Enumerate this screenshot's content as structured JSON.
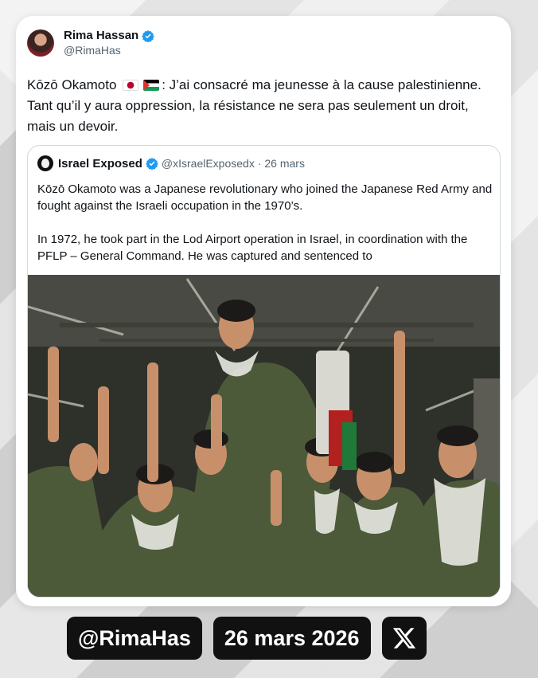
{
  "tweet": {
    "author": {
      "display_name": "Rima Hassan",
      "handle": "@RimaHas",
      "verified": true
    },
    "text_name": "Kōzō Okamoto",
    "flags": [
      "japan-flag-icon",
      "palestine-flag-icon"
    ],
    "text_body": ": J’ai consacré ma jeunesse à la cause palestinienne. Tant qu’il y aura oppression, la résistance ne sera pas seulement un droit, mais un devoir."
  },
  "quoted": {
    "display_name": "Israel Exposed",
    "handle": "@xIsraelExposedx",
    "date": "· 26 mars",
    "verified": true,
    "paragraphs": [
      "Kōzō Okamoto was a Japanese revolutionary who joined the Japanese Red Army and fought against the Israeli occupation in the 1970’s.",
      "In 1972, he took part in the Lod Airport operation in Israel, in coordination with the PFLP – General Command. He was captured and sentenced to"
    ]
  },
  "watermark": {
    "handle": "@RimaHas",
    "date": "26 mars 2026",
    "logo": "x-logo-icon"
  },
  "colors": {
    "verified_blue": "#1d9bf0",
    "text_primary": "#0f1419",
    "text_secondary": "#536471"
  }
}
